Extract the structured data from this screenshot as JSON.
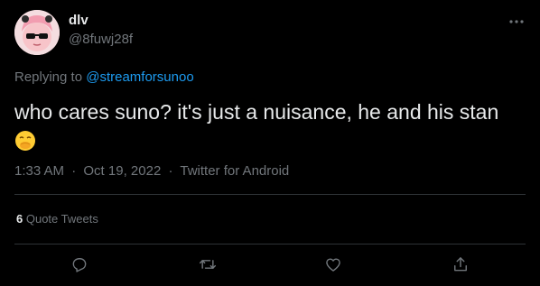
{
  "author": {
    "display_name": "dlv",
    "handle": "@8fuwj28f",
    "avatar": "avatar-icon"
  },
  "reply": {
    "prefix": "Replying to",
    "handle": "@streamforsunoo"
  },
  "tweet": {
    "text": "who cares suno? it's just a nuisance, he and his stan",
    "emoji": "face-with-hand-over-mouth-icon"
  },
  "meta": {
    "time": "1:33 AM",
    "separator": "·",
    "date": "Oct 19, 2022",
    "source": "Twitter for Android"
  },
  "stats": {
    "quote_count": "6",
    "quote_label": "Quote Tweets"
  },
  "actions": {
    "reply": "reply-icon",
    "retweet": "retweet-icon",
    "like": "like-icon",
    "share": "share-icon",
    "more": "more-icon"
  },
  "colors": {
    "background": "#000000",
    "text": "#e7e9ea",
    "secondary": "#71767b",
    "link": "#1d9bf0",
    "divider": "#2f3336"
  }
}
